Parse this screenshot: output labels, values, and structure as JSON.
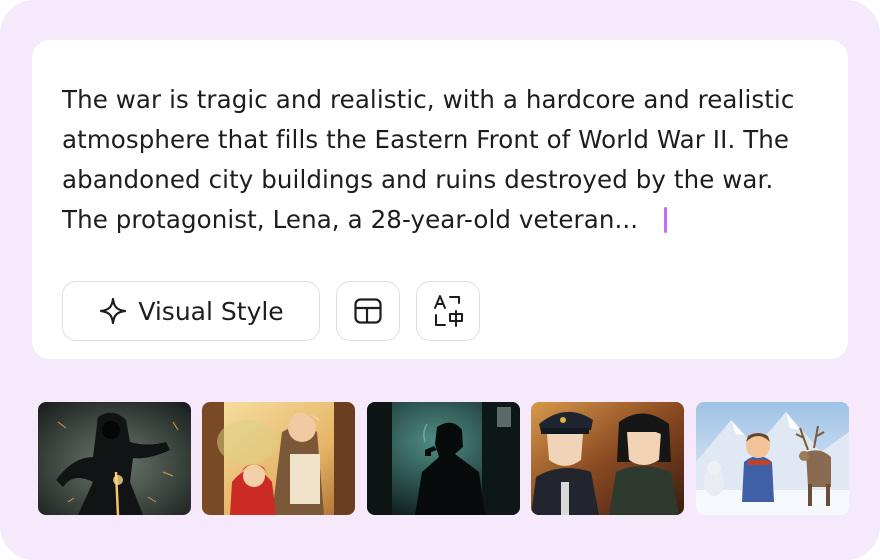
{
  "prompt": {
    "lines": [
      "The war is tragic and realistic, with a hardcore and realistic",
      "atmosphere that fills the Eastern Front of World War II. The",
      "abandoned city buildings and ruins destroyed by the war.",
      "The protagonist, Lena, a 28-year-old veteran..."
    ]
  },
  "toolbar": {
    "visual_style_label": "Visual Style",
    "visual_style_icon": "sparkle-icon",
    "layout_icon": "layout-icon",
    "translate_icon": "translate-icon"
  },
  "colors": {
    "background": "#f6e9fc",
    "card": "#ffffff",
    "caret": "#c86bf0",
    "border": "#dedee2",
    "text": "#1d1d1f"
  },
  "thumbnails": [
    {
      "name": "dark-warrior"
    },
    {
      "name": "girl-red-hood"
    },
    {
      "name": "silhouette-pipe"
    },
    {
      "name": "officer-duo"
    },
    {
      "name": "snow-reindeer"
    }
  ]
}
